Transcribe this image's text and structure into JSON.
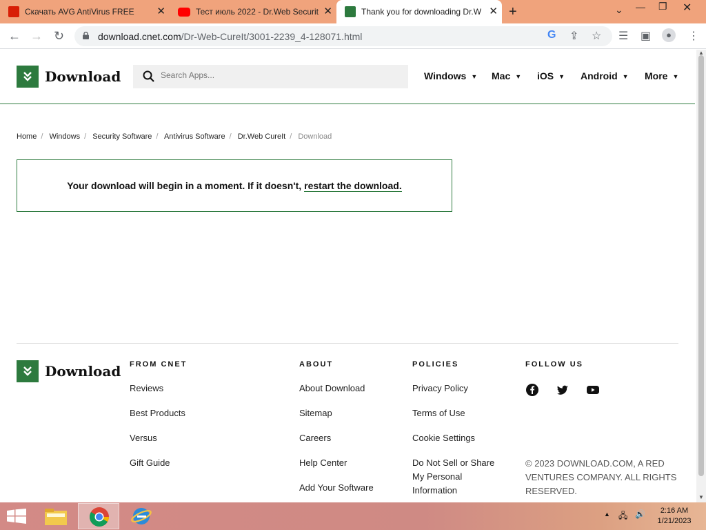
{
  "browser": {
    "tabs": [
      {
        "title": "Скачать AVG AntiVirus FREE"
      },
      {
        "title": "Тест июль 2022 - Dr.Web Securit"
      },
      {
        "title": "Thank you for downloading Dr.W"
      }
    ],
    "url_domain": "download.cnet.com",
    "url_path": "/Dr-Web-CureIt/3001-2239_4-128071.html"
  },
  "header": {
    "logo_text": "Download",
    "search_placeholder": "Search Apps...",
    "nav": [
      "Windows",
      "Mac",
      "iOS",
      "Android",
      "More"
    ]
  },
  "breadcrumb": [
    "Home",
    "Windows",
    "Security Software",
    "Antivirus Software",
    "Dr.Web CureIt",
    "Download"
  ],
  "download_box": {
    "message": "Your download will begin in a moment. If it doesn't,",
    "link": "restart the download."
  },
  "footer": {
    "logo_text": "Download",
    "from_cnet": {
      "heading": "FROM CNET",
      "links": [
        "Reviews",
        "Best Products",
        "Versus",
        "Gift Guide"
      ]
    },
    "about": {
      "heading": "ABOUT",
      "links": [
        "About Download",
        "Sitemap",
        "Careers",
        "Help Center",
        "Add Your Software"
      ]
    },
    "policies": {
      "heading": "POLICIES",
      "links": [
        "Privacy Policy",
        "Terms of Use",
        "Cookie Settings",
        "Do Not Sell or Share My Personal Information"
      ]
    },
    "follow": {
      "heading": "FOLLOW US"
    },
    "copyright": "© 2023 DOWNLOAD.COM, A RED VENTURES COMPANY. ALL RIGHTS RESERVED."
  },
  "taskbar": {
    "time": "2:16 AM",
    "date": "1/21/2023"
  },
  "colors": {
    "brand_green": "#2d7a3e",
    "tabbar": "#f0a37c"
  }
}
